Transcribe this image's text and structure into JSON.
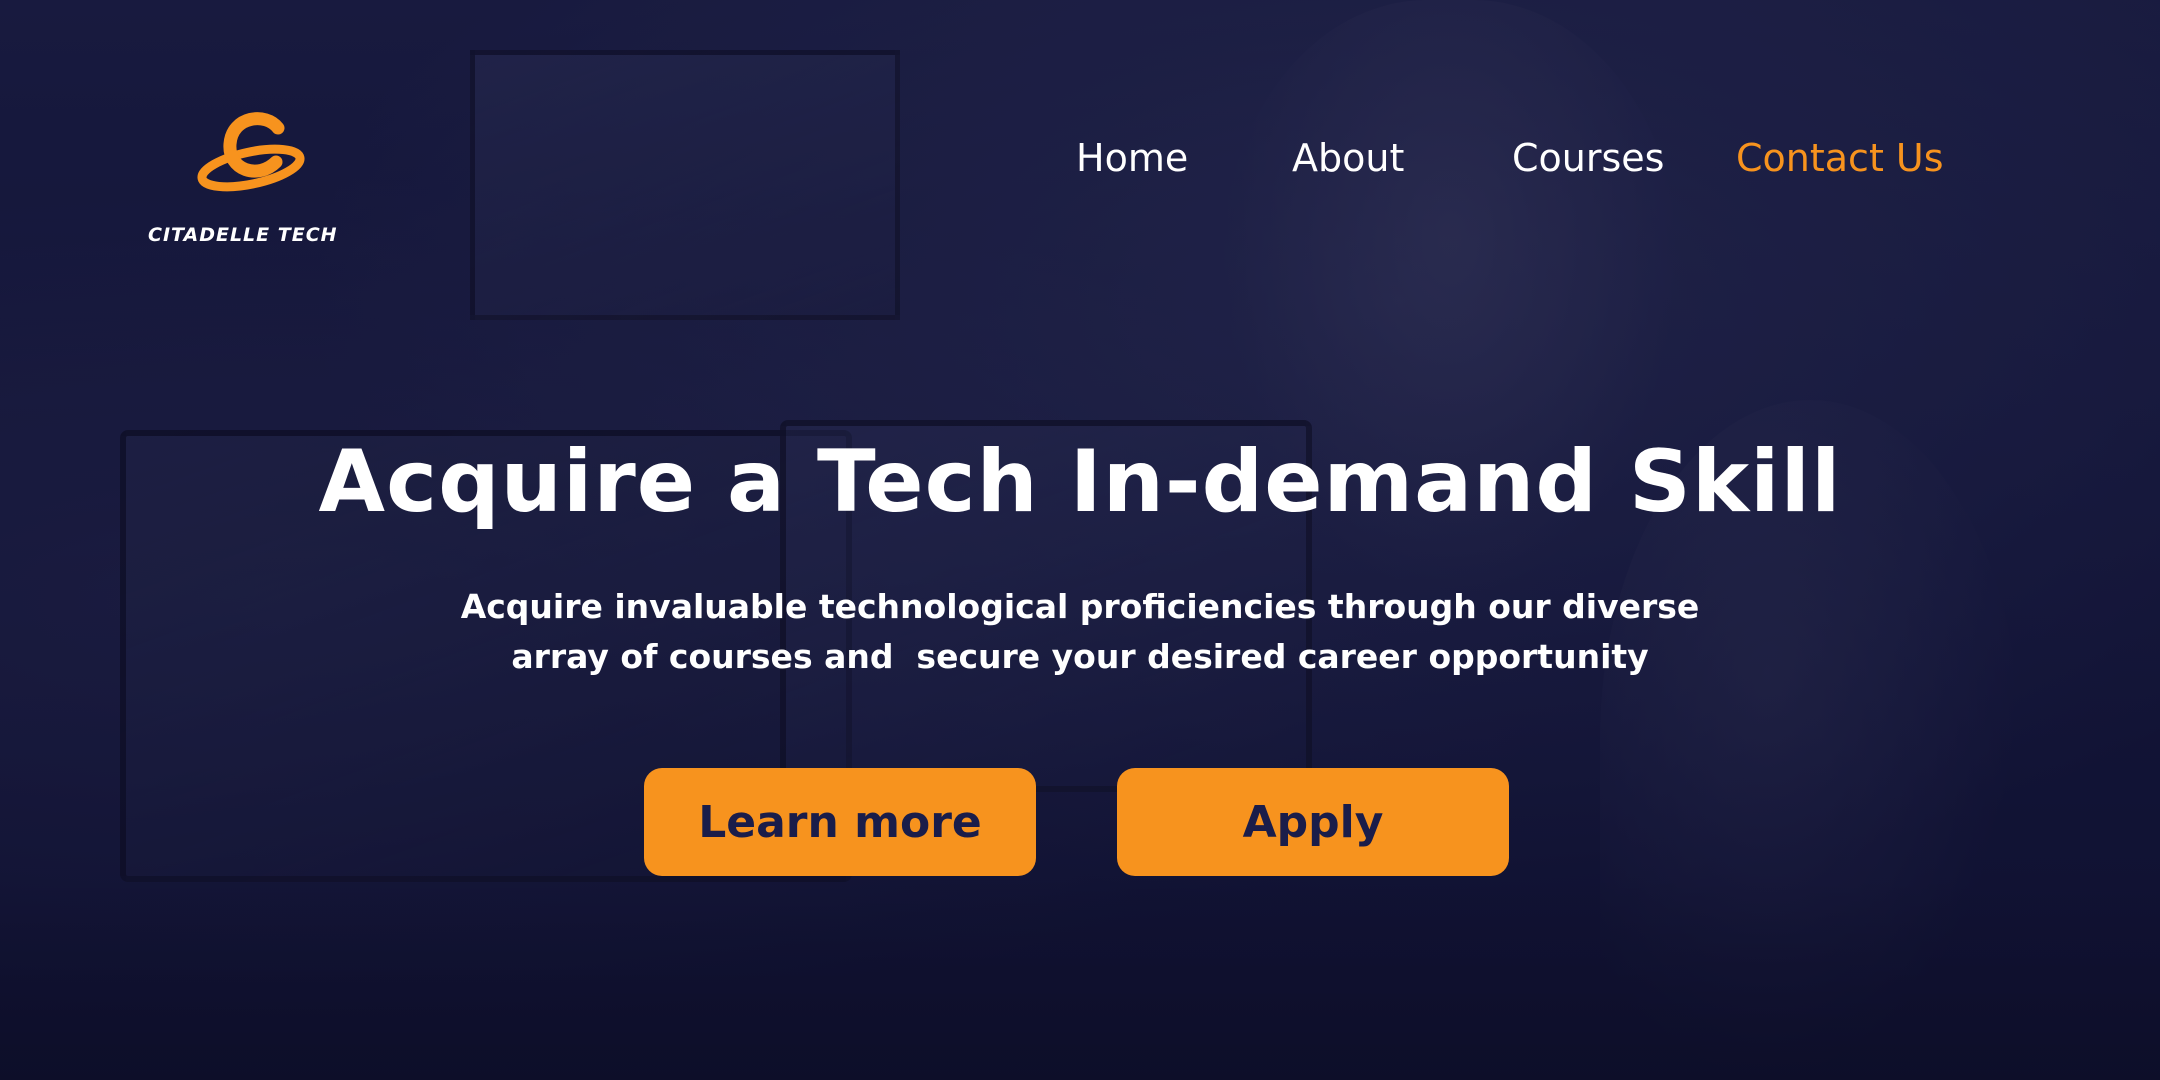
{
  "brand": {
    "name": "CITADELLE TECH",
    "accent_color": "#f7931e",
    "background_color": "#14163a",
    "text_color": "#ffffff",
    "button_text_color": "#1a1d4a"
  },
  "nav": {
    "items": [
      {
        "label": "Home",
        "active": false
      },
      {
        "label": "About",
        "active": false
      },
      {
        "label": "Courses",
        "active": false
      },
      {
        "label": "Contact Us",
        "active": true
      }
    ]
  },
  "hero": {
    "headline": "Acquire a Tech In-demand Skill",
    "subtext_line1": "Acquire invaluable technological proficiencies through our diverse",
    "subtext_line2": "array of courses and  secure your desired career opportunity",
    "learn_more_label": "Learn more",
    "apply_label": "Apply"
  },
  "icons": {
    "logo": "citadelle-logo-icon"
  }
}
